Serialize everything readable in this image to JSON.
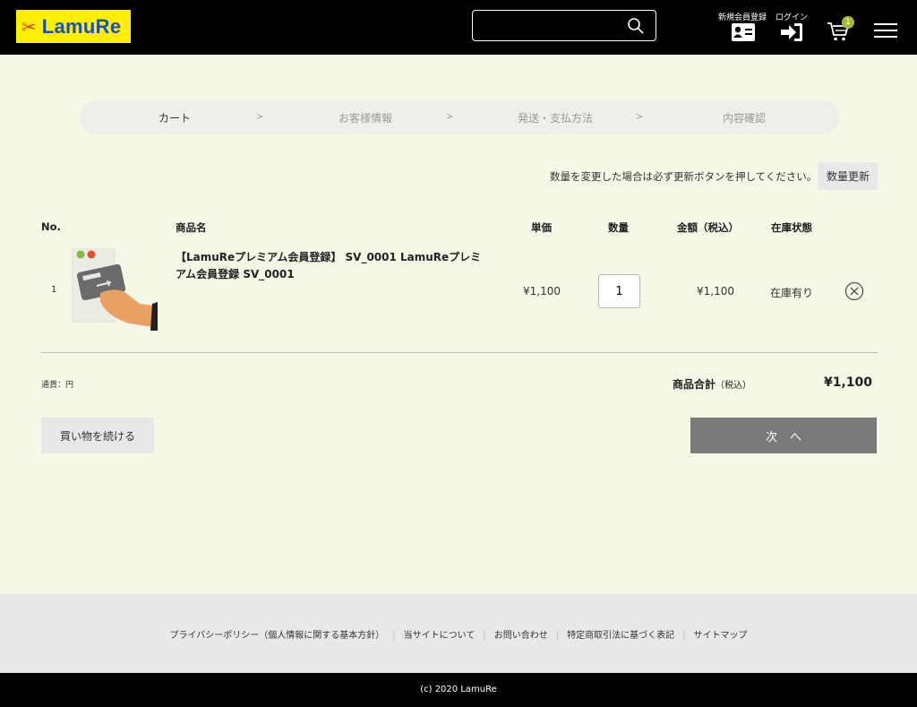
{
  "header": {
    "logo_text": "LamuRe",
    "search_placeholder": "",
    "register_label": "新規会員登録",
    "login_label": "ログイン",
    "cart_count": "1"
  },
  "steps": [
    "カート",
    "お客様情報",
    "発送・支払方法",
    "内容確認"
  ],
  "step_separator": ">",
  "cart": {
    "notice": "数量を変更した場合は必ず更新ボタンを押してください。",
    "update_button": "数量更新",
    "columns": {
      "no": "No.",
      "name": "商品名",
      "price": "単価",
      "qty": "数量",
      "amount": "金額（税込）",
      "stock": "在庫状態"
    },
    "items": [
      {
        "no": "1",
        "name": "【LamuReプレミアム会員登録】 SV_0001 LamuReプレミアム会員登録 SV_0001",
        "price": "¥1,100",
        "qty": "1",
        "amount": "¥1,100",
        "stock": "在庫有り"
      }
    ],
    "currency_label": "通貨：円",
    "subtotal_label": "商品合計",
    "subtotal_tax": "（税込）",
    "subtotal_value": "¥1,100",
    "continue_button": "買い物を続ける",
    "next_button": "次",
    "next_arrow": "へ"
  },
  "footer": {
    "links": [
      "プライバシーポリシー（個人情報に関する基本方針）",
      "当サイトについて",
      "お問い合わせ",
      "特定商取引法に基づく表記",
      "サイトマップ"
    ],
    "copyright": "(c) 2020 LamuRe"
  },
  "colors": {
    "background": "#f7f7e7",
    "header": "#000000",
    "logo_bg": "#ffef00",
    "logo_text": "#1a4fb5",
    "badge": "#a8b735",
    "next_button": "#7a7a7a"
  }
}
